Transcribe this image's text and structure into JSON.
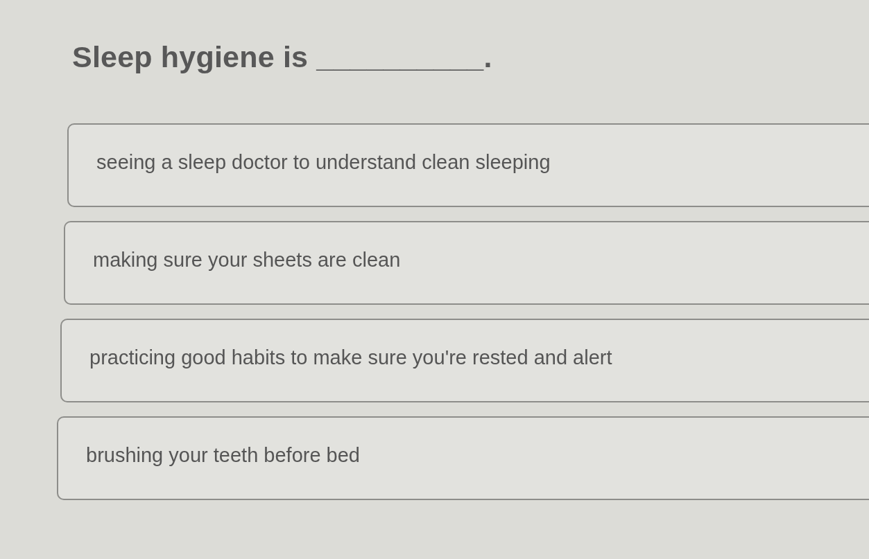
{
  "question": {
    "text": "Sleep hygiene is __________."
  },
  "options": [
    {
      "text": "seeing a sleep doctor to understand clean sleeping",
      "selected": false
    },
    {
      "text": "making sure your sheets are clean",
      "selected": false
    },
    {
      "text": "practicing good habits to make sure you're rested and alert",
      "selected": false
    },
    {
      "text": "brushing your teeth before bed",
      "selected": false
    }
  ]
}
